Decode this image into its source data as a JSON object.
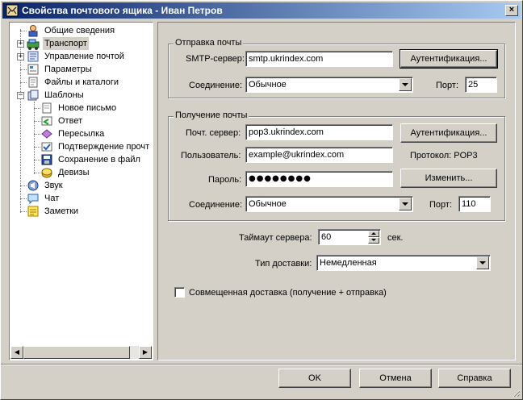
{
  "window": {
    "title": "Свойства почтового ящика - Иван Петров",
    "close_label": "×"
  },
  "tree": {
    "items": [
      {
        "label": "Общие сведения",
        "icon": "user-info-icon"
      },
      {
        "label": "Транспорт",
        "icon": "transport-icon"
      },
      {
        "label": "Управление почтой",
        "icon": "mail-manage-icon"
      },
      {
        "label": "Параметры",
        "icon": "parameters-icon"
      },
      {
        "label": "Файлы и каталоги",
        "icon": "files-icon"
      },
      {
        "label": "Шаблоны",
        "icon": "templates-icon"
      },
      {
        "label": "Новое письмо",
        "icon": "new-letter-icon"
      },
      {
        "label": "Ответ",
        "icon": "reply-icon"
      },
      {
        "label": "Пересылка",
        "icon": "forward-icon"
      },
      {
        "label": "Подтверждение прочт",
        "icon": "read-receipt-icon"
      },
      {
        "label": "Сохранение в файл",
        "icon": "save-file-icon"
      },
      {
        "label": "Девизы",
        "icon": "mottos-icon"
      },
      {
        "label": "Звук",
        "icon": "sound-icon"
      },
      {
        "label": "Чат",
        "icon": "chat-icon"
      },
      {
        "label": "Заметки",
        "icon": "notes-icon"
      }
    ],
    "selected": "Транспорт"
  },
  "send": {
    "group_title": "Отправка почты",
    "smtp_label": "SMTP-сервер:",
    "smtp_value": "smtp.ukrindex.com",
    "auth_button": "Аутентификация...",
    "connection_label": "Соединение:",
    "connection_value": "Обычное",
    "port_label": "Порт:",
    "port_value": "25"
  },
  "receive": {
    "group_title": "Получение почты",
    "server_label": "Почт. сервер:",
    "server_value": "pop3.ukrindex.com",
    "auth_button": "Аутентификация...",
    "user_label": "Пользователь:",
    "user_value": "example@ukrindex.com",
    "protocol_text": "Протокол: POP3",
    "password_label": "Пароль:",
    "password_value": "●●●●●●●●",
    "change_button": "Изменить...",
    "connection_label": "Соединение:",
    "connection_value": "Обычное",
    "port_label": "Порт:",
    "port_value": "110"
  },
  "timeout": {
    "label": "Таймаут сервера:",
    "value": "60",
    "unit": "сек."
  },
  "delivery": {
    "label": "Тип доставки:",
    "value": "Немедленная"
  },
  "combined": {
    "label": "Совмещенная доставка (получение + отправка)",
    "checked": false
  },
  "buttons": {
    "ok": "OK",
    "cancel": "Отмена",
    "help": "Справка"
  }
}
